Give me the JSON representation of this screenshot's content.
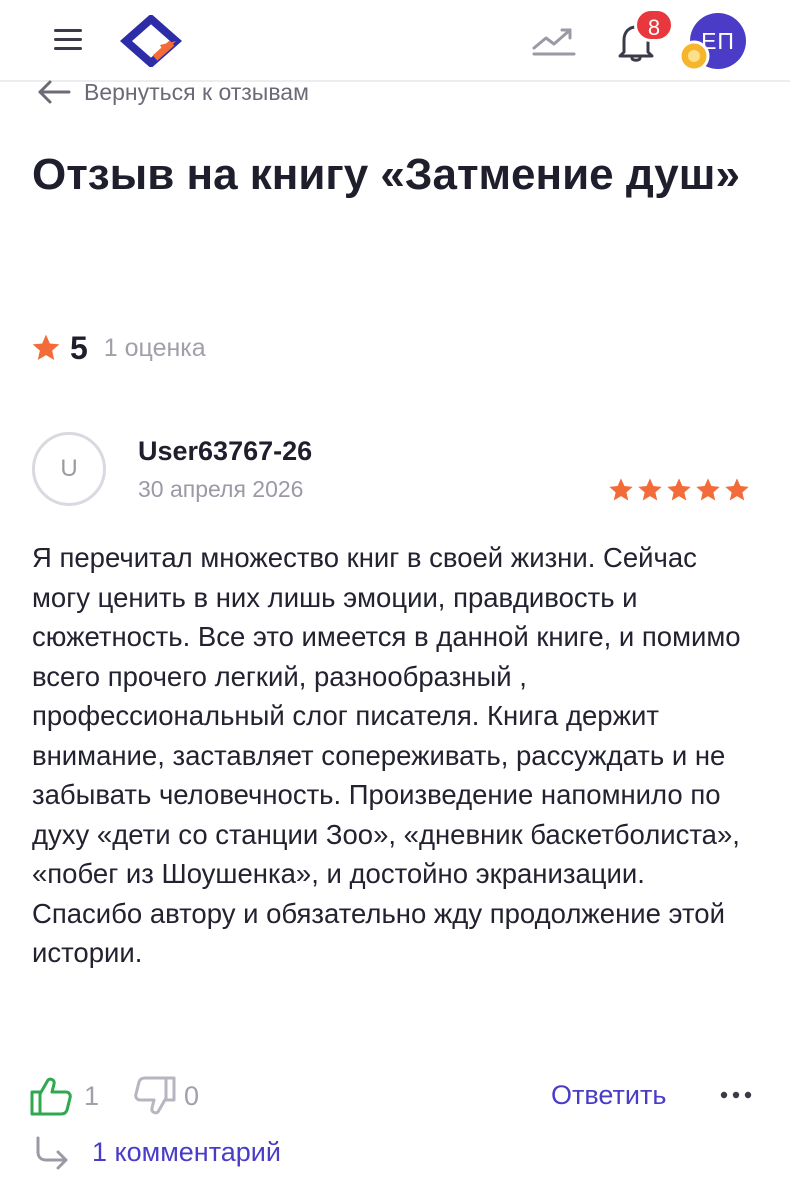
{
  "header": {
    "notifications_count": "8",
    "avatar_initials": "ЕП",
    "colors": {
      "brand_blue": "#2d2da8",
      "brand_orange": "#f26b38",
      "badge_red": "#e8383d",
      "avatar_bg": "#4b3cc8",
      "coin": "#f5b62e"
    },
    "icons": [
      "menu-icon",
      "logo",
      "trending-chart-icon",
      "bell-icon",
      "coin-icon"
    ]
  },
  "nav": {
    "back_label": "Вернуться к отзывам"
  },
  "page": {
    "title": "Отзыв на книгу «Затмение душ»"
  },
  "rating": {
    "score": "5",
    "count_label": "1 оценка",
    "star_color": "#f26b38"
  },
  "review": {
    "avatar_letter": "U",
    "user_name": "User63767-26",
    "date": "30 апреля 2026",
    "stars": 5,
    "text": "Я перечитал множество книг в своей жизни. Сейчас могу ценить в них лишь эмоции, правдивость и сюжетность. Все это имеется в данной книге, и помимо всего прочего легкий, разнообразный , профессиональный слог писателя. Книга держит внимание, заставляет сопереживать, рассуждать и не забывать человечность. Произведение напомнило по духу «дети со станции Зоо», «дневник баскетболиста», «побег из Шоушенка», и достойно экранизации. Спасибо автору и обязательно жду продолжение этой истории."
  },
  "actions": {
    "likes": "1",
    "dislikes": "0",
    "reply_label": "Ответить",
    "comments_label": "1 комментарий",
    "colors": {
      "like_green": "#2fa84f",
      "link_purple": "#4b3cc8"
    }
  }
}
